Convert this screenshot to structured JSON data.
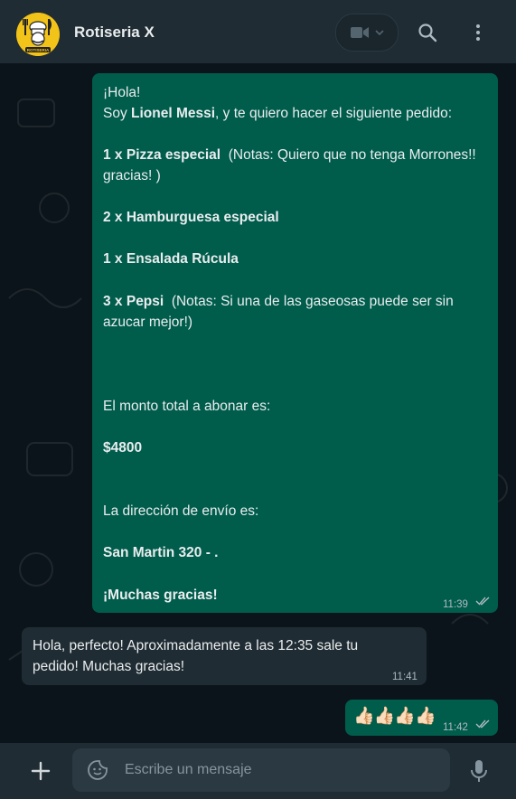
{
  "header": {
    "contact_name": "Rotiseria X",
    "avatar_logo_text": "ROTISERIA",
    "icons": [
      "video-call-icon",
      "chevron-down-icon",
      "search-icon",
      "menu-icon"
    ]
  },
  "messages": [
    {
      "direction": "outgoing",
      "time": "11:39",
      "lines": {
        "l1": "¡Hola!",
        "l2_a": "Soy ",
        "l2_b": "Lionel Messi",
        "l2_c": ", y te quiero hacer el siguiente pedido:",
        "l3_a": "1 x Pizza especial",
        "l3_b": "  (Notas: Quiero que no tenga Morrones!!",
        "l4": "gracias! )",
        "l5": "2 x Hamburguesa especial",
        "l6": "1 x Ensalada Rúcula",
        "l7_a": "3 x Pepsi",
        "l7_b": "  (Notas: Si una de las gaseosas puede ser sin",
        "l8": "azucar mejor!)",
        "l9": "El monto total a abonar es:",
        "l10": "$4800",
        "l11": "La dirección de envío es:",
        "l12": "San Martin 320 - .",
        "l13": "¡Muchas gracias!"
      }
    },
    {
      "direction": "incoming",
      "time": "11:41",
      "line1": "Hola, perfecto! Aproximadamente a las 12:35 sale tu",
      "line2": "pedido! Muchas gracias!"
    },
    {
      "direction": "outgoing",
      "time": "11:42",
      "emojis": "👍🏻👍🏻👍🏻👍🏻"
    }
  ],
  "footer": {
    "placeholder": "Escribe un mensaje",
    "icons": [
      "plus-icon",
      "sticker-icon",
      "microphone-icon"
    ]
  },
  "colors": {
    "header_bg": "#202c33",
    "chat_bg": "#0b141a",
    "outgoing_bubble": "#005c4b",
    "incoming_bubble": "#202c33",
    "read_ticks": "#aebac1"
  }
}
